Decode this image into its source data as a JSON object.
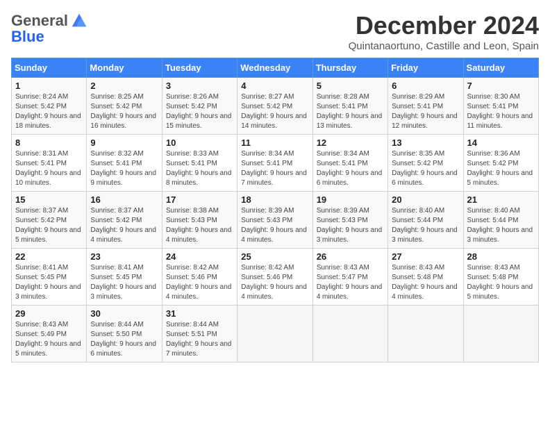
{
  "logo": {
    "general": "General",
    "blue": "Blue"
  },
  "header": {
    "month": "December 2024",
    "subtitle": "Quintanaortuno, Castille and Leon, Spain"
  },
  "weekdays": [
    "Sunday",
    "Monday",
    "Tuesday",
    "Wednesday",
    "Thursday",
    "Friday",
    "Saturday"
  ],
  "weeks": [
    [
      {
        "day": "1",
        "sunrise": "8:24 AM",
        "sunset": "5:42 PM",
        "daylight": "9 hours and 18 minutes."
      },
      {
        "day": "2",
        "sunrise": "8:25 AM",
        "sunset": "5:42 PM",
        "daylight": "9 hours and 16 minutes."
      },
      {
        "day": "3",
        "sunrise": "8:26 AM",
        "sunset": "5:42 PM",
        "daylight": "9 hours and 15 minutes."
      },
      {
        "day": "4",
        "sunrise": "8:27 AM",
        "sunset": "5:42 PM",
        "daylight": "9 hours and 14 minutes."
      },
      {
        "day": "5",
        "sunrise": "8:28 AM",
        "sunset": "5:41 PM",
        "daylight": "9 hours and 13 minutes."
      },
      {
        "day": "6",
        "sunrise": "8:29 AM",
        "sunset": "5:41 PM",
        "daylight": "9 hours and 12 minutes."
      },
      {
        "day": "7",
        "sunrise": "8:30 AM",
        "sunset": "5:41 PM",
        "daylight": "9 hours and 11 minutes."
      }
    ],
    [
      {
        "day": "8",
        "sunrise": "8:31 AM",
        "sunset": "5:41 PM",
        "daylight": "9 hours and 10 minutes."
      },
      {
        "day": "9",
        "sunrise": "8:32 AM",
        "sunset": "5:41 PM",
        "daylight": "9 hours and 9 minutes."
      },
      {
        "day": "10",
        "sunrise": "8:33 AM",
        "sunset": "5:41 PM",
        "daylight": "9 hours and 8 minutes."
      },
      {
        "day": "11",
        "sunrise": "8:34 AM",
        "sunset": "5:41 PM",
        "daylight": "9 hours and 7 minutes."
      },
      {
        "day": "12",
        "sunrise": "8:34 AM",
        "sunset": "5:41 PM",
        "daylight": "9 hours and 6 minutes."
      },
      {
        "day": "13",
        "sunrise": "8:35 AM",
        "sunset": "5:42 PM",
        "daylight": "9 hours and 6 minutes."
      },
      {
        "day": "14",
        "sunrise": "8:36 AM",
        "sunset": "5:42 PM",
        "daylight": "9 hours and 5 minutes."
      }
    ],
    [
      {
        "day": "15",
        "sunrise": "8:37 AM",
        "sunset": "5:42 PM",
        "daylight": "9 hours and 5 minutes."
      },
      {
        "day": "16",
        "sunrise": "8:37 AM",
        "sunset": "5:42 PM",
        "daylight": "9 hours and 4 minutes."
      },
      {
        "day": "17",
        "sunrise": "8:38 AM",
        "sunset": "5:43 PM",
        "daylight": "9 hours and 4 minutes."
      },
      {
        "day": "18",
        "sunrise": "8:39 AM",
        "sunset": "5:43 PM",
        "daylight": "9 hours and 4 minutes."
      },
      {
        "day": "19",
        "sunrise": "8:39 AM",
        "sunset": "5:43 PM",
        "daylight": "9 hours and 3 minutes."
      },
      {
        "day": "20",
        "sunrise": "8:40 AM",
        "sunset": "5:44 PM",
        "daylight": "9 hours and 3 minutes."
      },
      {
        "day": "21",
        "sunrise": "8:40 AM",
        "sunset": "5:44 PM",
        "daylight": "9 hours and 3 minutes."
      }
    ],
    [
      {
        "day": "22",
        "sunrise": "8:41 AM",
        "sunset": "5:45 PM",
        "daylight": "9 hours and 3 minutes."
      },
      {
        "day": "23",
        "sunrise": "8:41 AM",
        "sunset": "5:45 PM",
        "daylight": "9 hours and 3 minutes."
      },
      {
        "day": "24",
        "sunrise": "8:42 AM",
        "sunset": "5:46 PM",
        "daylight": "9 hours and 4 minutes."
      },
      {
        "day": "25",
        "sunrise": "8:42 AM",
        "sunset": "5:46 PM",
        "daylight": "9 hours and 4 minutes."
      },
      {
        "day": "26",
        "sunrise": "8:43 AM",
        "sunset": "5:47 PM",
        "daylight": "9 hours and 4 minutes."
      },
      {
        "day": "27",
        "sunrise": "8:43 AM",
        "sunset": "5:48 PM",
        "daylight": "9 hours and 4 minutes."
      },
      {
        "day": "28",
        "sunrise": "8:43 AM",
        "sunset": "5:48 PM",
        "daylight": "9 hours and 5 minutes."
      }
    ],
    [
      {
        "day": "29",
        "sunrise": "8:43 AM",
        "sunset": "5:49 PM",
        "daylight": "9 hours and 5 minutes."
      },
      {
        "day": "30",
        "sunrise": "8:44 AM",
        "sunset": "5:50 PM",
        "daylight": "9 hours and 6 minutes."
      },
      {
        "day": "31",
        "sunrise": "8:44 AM",
        "sunset": "5:51 PM",
        "daylight": "9 hours and 7 minutes."
      },
      null,
      null,
      null,
      null
    ]
  ],
  "labels": {
    "sunrise": "Sunrise:",
    "sunset": "Sunset:",
    "daylight": "Daylight:"
  }
}
